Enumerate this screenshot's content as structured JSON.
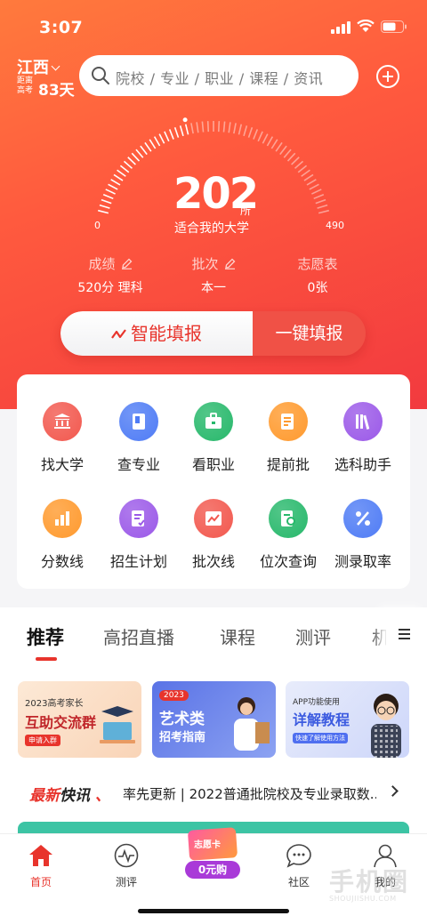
{
  "status": {
    "time": "3:07"
  },
  "header": {
    "province": "江西",
    "countdown_prefix": "距离高考",
    "countdown_days": "83天",
    "search_placeholder": "院校 / 专业 / 职业 / 课程 / 资讯"
  },
  "gauge": {
    "count": "202",
    "unit": "所",
    "caption": "适合我的大学",
    "min": "0",
    "max": "490",
    "value": 202,
    "max_value": 490
  },
  "stats": [
    {
      "label": "成绩",
      "value": "520分  理科",
      "editable": true
    },
    {
      "label": "批次",
      "value": "本一",
      "editable": true
    },
    {
      "label": "志愿表",
      "value": "0张",
      "editable": false
    }
  ],
  "actions": {
    "smart_fill": "智能填报",
    "one_click_fill": "一键填报"
  },
  "features": [
    {
      "label": "找大学",
      "icon": "university-icon",
      "color": "#f2584e"
    },
    {
      "label": "查专业",
      "icon": "book-icon",
      "color": "#4f7cf5"
    },
    {
      "label": "看职业",
      "icon": "briefcase-icon",
      "color": "#27b86b"
    },
    {
      "label": "提前批",
      "icon": "document-icon",
      "color": "#ff9a2e"
    },
    {
      "label": "选科助手",
      "icon": "books-icon",
      "color": "#9b59e8"
    },
    {
      "label": "分数线",
      "icon": "bar-chart-icon",
      "color": "#ff9a2e"
    },
    {
      "label": "招生计划",
      "icon": "plan-icon",
      "color": "#9b59e8"
    },
    {
      "label": "批次线",
      "icon": "line-chart-icon",
      "color": "#f2584e"
    },
    {
      "label": "位次查询",
      "icon": "rank-search-icon",
      "color": "#27b86b"
    },
    {
      "label": "测录取率",
      "icon": "percent-icon",
      "color": "#4f7cf5"
    }
  ],
  "tabs": [
    "推荐",
    "高招直播",
    "课程",
    "测评",
    "机"
  ],
  "banners": [
    {
      "top": "2023高考家长",
      "title": "互助交流群",
      "cta": "申请入群"
    },
    {
      "year": "2023",
      "title": "艺术类",
      "subtitle": "招考指南"
    },
    {
      "top": "APP功能使用",
      "title": "详解教程",
      "cta": "快速了解使用方法"
    }
  ],
  "news": {
    "brand_a": "最新",
    "brand_b": "快讯",
    "text": "率先更新 | 2022普通批院校及专业录取数..."
  },
  "bottom_nav": [
    {
      "label": "首页",
      "icon": "home-icon",
      "active": true
    },
    {
      "label": "测评",
      "icon": "pulse-icon",
      "active": false
    },
    {
      "label": "",
      "icon": "promo-icon",
      "active": false
    },
    {
      "label": "社区",
      "icon": "chat-icon",
      "active": false
    },
    {
      "label": "我的",
      "icon": "person-icon",
      "active": false
    }
  ],
  "promo": {
    "card": "志愿卡",
    "price": "0元购"
  },
  "watermark": {
    "text": "手机圈",
    "url_text": "SHOUJIISHU.COM"
  },
  "colors": {
    "accent": "#e8342c",
    "hero": "#f5453e"
  }
}
